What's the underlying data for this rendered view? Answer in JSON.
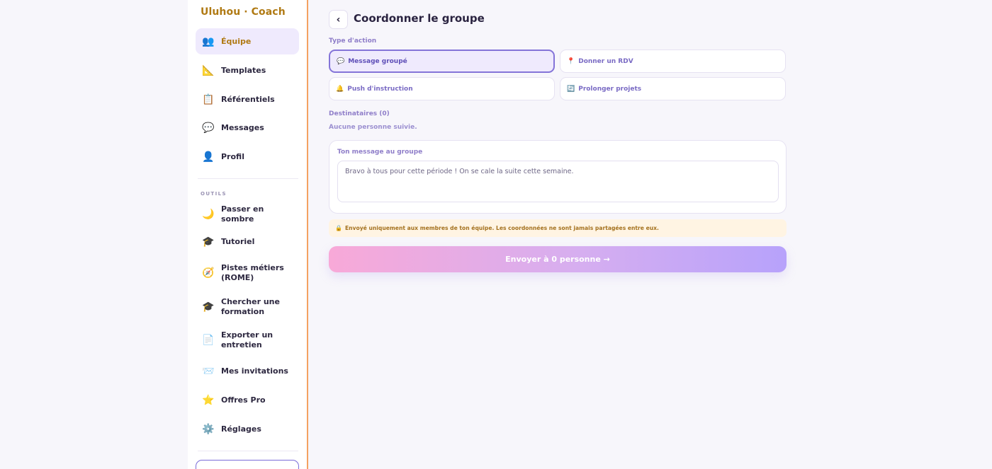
{
  "brand": "Uluhou · Coach",
  "sidebar": {
    "items": [
      {
        "label": "Équipe",
        "icon": "👥",
        "active": true
      },
      {
        "label": "Templates",
        "icon": "📐"
      },
      {
        "label": "Référentiels",
        "icon": "📋"
      },
      {
        "label": "Messages",
        "icon": "💬"
      },
      {
        "label": "Profil",
        "icon": "👤"
      }
    ],
    "section_label": "OUTILS",
    "tools": [
      {
        "label": "Passer en sombre",
        "icon": "🌙"
      },
      {
        "label": "Tutoriel",
        "icon": "🎓"
      },
      {
        "label": "Pistes métiers (ROME)",
        "icon": "🧭"
      },
      {
        "label": "Chercher une formation",
        "icon": "🎓"
      },
      {
        "label": "Exporter un entretien",
        "icon": "📄"
      },
      {
        "label": "Mes invitations",
        "icon": "📨"
      },
      {
        "label": "Offres Pro",
        "icon": "⭐"
      },
      {
        "label": "Réglages",
        "icon": "⚙️"
      }
    ]
  },
  "main": {
    "back_label": "‹",
    "title": "Coordonner le groupe",
    "action_type_label": "Type d'action",
    "actions": [
      {
        "label": "Message groupé",
        "icon": "💬",
        "selected": true
      },
      {
        "label": "Donner un RDV",
        "icon": "📍"
      },
      {
        "label": "Push d'instruction",
        "icon": "🔔"
      },
      {
        "label": "Prolonger projets",
        "icon": "🔄"
      }
    ],
    "recipients_label": "Destinataires (0)",
    "no_recipients": "Aucune personne suivie.",
    "message_label": "Ton message au groupe",
    "message_value": "Bravo à tous pour cette période ! On se cale la suite cette semaine.",
    "notice_icon": "🔒",
    "notice": "Envoyé uniquement aux membres de ton équipe. Les coordonnées ne sont jamais partagées entre eux.",
    "send_label": "Envoyer à 0 personne →"
  },
  "colors": {
    "accent": "#8474d8",
    "brand": "#b07a14",
    "sidebar_border": "#f4a261"
  }
}
